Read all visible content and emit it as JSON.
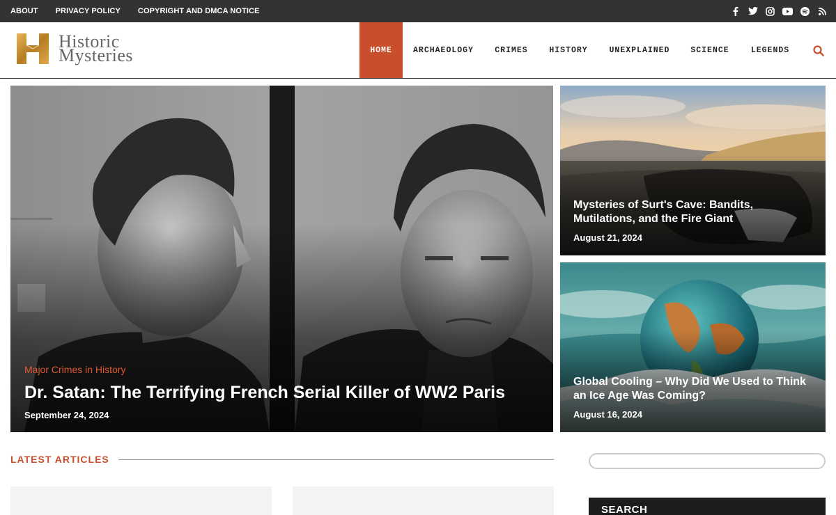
{
  "topbar": {
    "links": [
      "ABOUT",
      "PRIVACY POLICY",
      "COPYRIGHT AND DMCA NOTICE"
    ],
    "social_icons": [
      "facebook-icon",
      "twitter-icon",
      "instagram-icon",
      "youtube-icon",
      "spotify-icon",
      "rss-icon"
    ]
  },
  "brand": {
    "line1": "Historic",
    "line2": "Mysteries",
    "accent": "#c8932f"
  },
  "nav": {
    "items": [
      "HOME",
      "ARCHAEOLOGY",
      "CRIMES",
      "HISTORY",
      "UNEXPLAINED",
      "SCIENCE",
      "LEGENDS"
    ],
    "active": "HOME",
    "accent": "#c94f2c"
  },
  "hero": {
    "main": {
      "category": "Major Crimes in History",
      "title": "Dr. Satan: The Terrifying French Serial Killer of WW2 Paris",
      "date": "September 24, 2024"
    },
    "side": [
      {
        "title": "Mysteries of Surt's Cave: Bandits, Mutilations, and the Fire Giant",
        "date": "August 21, 2024"
      },
      {
        "title": "Global Cooling – Why Did We Used to Think an Ice Age Was Coming?",
        "date": "August 16, 2024"
      }
    ]
  },
  "latest": {
    "heading": "LATEST ARTICLES"
  },
  "sidebar": {
    "search_placeholder": "",
    "search_heading": "SEARCH"
  }
}
